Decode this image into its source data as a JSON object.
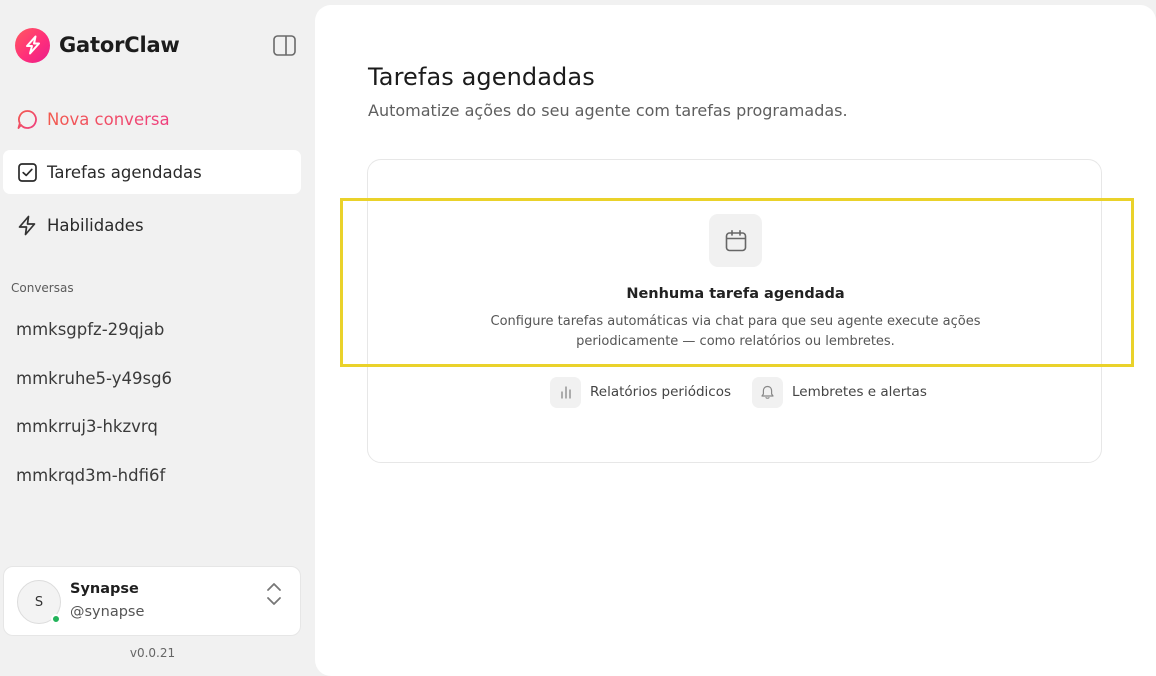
{
  "app": {
    "name": "GatorClaw",
    "version": "v0.0.21"
  },
  "sidebar": {
    "nav": [
      {
        "label": "Nova conversa",
        "icon": "chat-plus-icon"
      },
      {
        "label": "Tarefas agendadas",
        "icon": "checkbox-icon",
        "active": true
      },
      {
        "label": "Habilidades",
        "icon": "lightning-icon"
      }
    ],
    "section_label": "Conversas",
    "conversations": [
      "mmksgpfz-29qjab",
      "mmkruhe5-y49sg6",
      "mmkrruj3-hkzvrq",
      "mmkrqd3m-hdfi6f"
    ]
  },
  "user": {
    "initial": "S",
    "name": "Synapse",
    "handle": "@synapse",
    "status": "online"
  },
  "main": {
    "title": "Tarefas agendadas",
    "subtitle": "Automatize ações do seu agente com tarefas programadas.",
    "empty": {
      "icon": "calendar-icon",
      "title": "Nenhuma tarefa agendada",
      "description": "Configure tarefas automáticas via chat para que seu agente execute ações periodicamente — como relatórios ou lembretes."
    },
    "chips": [
      {
        "label": "Relatórios periódicos",
        "icon": "bar-chart-icon"
      },
      {
        "label": "Lembretes e alertas",
        "icon": "bell-icon"
      }
    ]
  },
  "colors": {
    "accent": "#ef3f7f",
    "highlight": "#ead22a",
    "online": "#22b35a"
  }
}
